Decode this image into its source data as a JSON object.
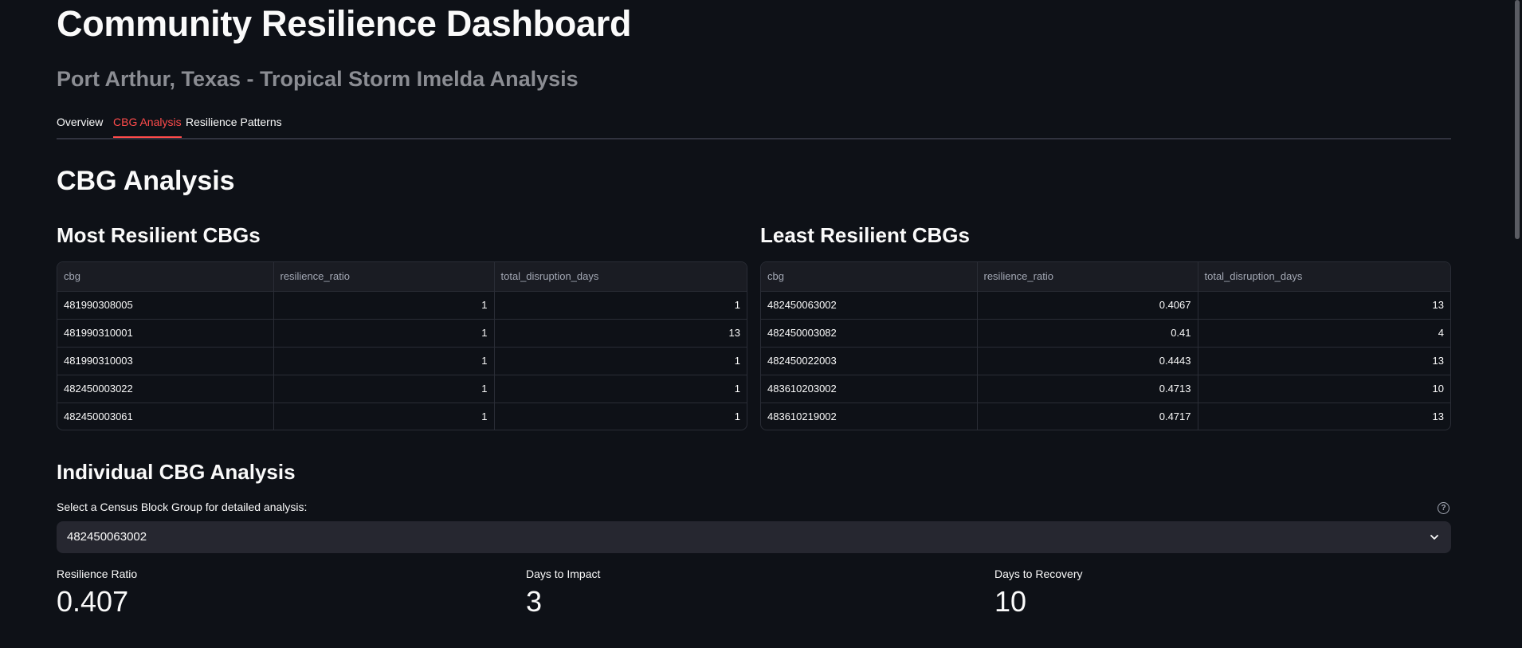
{
  "header": {
    "title": "Community Resilience Dashboard",
    "subtitle": "Port Arthur, Texas - Tropical Storm Imelda Analysis"
  },
  "tabs": [
    {
      "label": "Overview",
      "active": false
    },
    {
      "label": "CBG Analysis",
      "active": true
    },
    {
      "label": "Resilience Patterns",
      "active": false
    }
  ],
  "section": {
    "title": "CBG Analysis"
  },
  "most_resilient": {
    "title": "Most Resilient CBGs",
    "columns": [
      "cbg",
      "resilience_ratio",
      "total_disruption_days"
    ],
    "rows": [
      [
        "481990308005",
        "1",
        "1"
      ],
      [
        "481990310001",
        "1",
        "13"
      ],
      [
        "481990310003",
        "1",
        "1"
      ],
      [
        "482450003022",
        "1",
        "1"
      ],
      [
        "482450003061",
        "1",
        "1"
      ]
    ]
  },
  "least_resilient": {
    "title": "Least Resilient CBGs",
    "columns": [
      "cbg",
      "resilience_ratio",
      "total_disruption_days"
    ],
    "rows": [
      [
        "482450063002",
        "0.4067",
        "13"
      ],
      [
        "482450003082",
        "0.41",
        "4"
      ],
      [
        "482450022003",
        "0.4443",
        "13"
      ],
      [
        "483610203002",
        "0.4713",
        "10"
      ],
      [
        "483610219002",
        "0.4717",
        "13"
      ]
    ]
  },
  "individual": {
    "title": "Individual CBG Analysis",
    "select_label": "Select a Census Block Group for detailed analysis:",
    "help_icon": "question-circle-icon",
    "selected": "482450063002",
    "chevron_icon": "chevron-down-icon"
  },
  "metrics": [
    {
      "label": "Resilience Ratio",
      "value": "0.407"
    },
    {
      "label": "Days to Impact",
      "value": "3"
    },
    {
      "label": "Days to Recovery",
      "value": "10"
    }
  ],
  "colors": {
    "background": "#0e1117",
    "accent": "#ff4b4b",
    "subtitle": "#8b8d93",
    "widget_bg": "#262730"
  }
}
